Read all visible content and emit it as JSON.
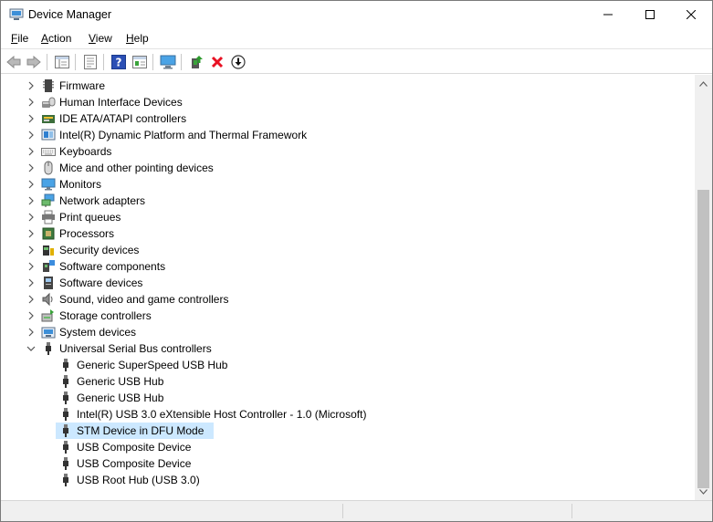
{
  "window": {
    "title": "Device Manager"
  },
  "menu": [
    {
      "label": "File"
    },
    {
      "label": "Action"
    },
    {
      "label": "View"
    },
    {
      "label": "Help"
    }
  ],
  "toolbar": {
    "buttons": [
      {
        "icon": "back-arrow-icon"
      },
      {
        "icon": "forward-arrow-icon"
      },
      {
        "icon": "show-hide-console-tree-icon"
      },
      {
        "icon": "properties-icon"
      },
      {
        "icon": "help-icon"
      },
      {
        "icon": "view-pane-icon"
      },
      {
        "icon": "monitor-icon"
      },
      {
        "icon": "update-driver-icon"
      },
      {
        "icon": "uninstall-red-x-icon"
      },
      {
        "icon": "download-circle-icon"
      }
    ]
  },
  "tree": {
    "categories": [
      {
        "label": "Firmware",
        "icon": "firmware-icon",
        "expanded": false
      },
      {
        "label": "Human Interface Devices",
        "icon": "hid-icon",
        "expanded": false
      },
      {
        "label": "IDE ATA/ATAPI controllers",
        "icon": "ide-icon",
        "expanded": false
      },
      {
        "label": "Intel(R) Dynamic Platform and Thermal Framework",
        "icon": "thermal-framework-icon",
        "expanded": false
      },
      {
        "label": "Keyboards",
        "icon": "keyboard-icon",
        "expanded": false
      },
      {
        "label": "Mice and other pointing devices",
        "icon": "mouse-icon",
        "expanded": false
      },
      {
        "label": "Monitors",
        "icon": "monitor-icon",
        "expanded": false
      },
      {
        "label": "Network adapters",
        "icon": "network-icon",
        "expanded": false
      },
      {
        "label": "Print queues",
        "icon": "printer-icon",
        "expanded": false
      },
      {
        "label": "Processors",
        "icon": "processor-icon",
        "expanded": false
      },
      {
        "label": "Security devices",
        "icon": "security-icon",
        "expanded": false
      },
      {
        "label": "Software components",
        "icon": "software-component-icon",
        "expanded": false
      },
      {
        "label": "Software devices",
        "icon": "software-device-icon",
        "expanded": false
      },
      {
        "label": "Sound, video and game controllers",
        "icon": "speaker-icon",
        "expanded": false
      },
      {
        "label": "Storage controllers",
        "icon": "storage-icon",
        "expanded": false
      },
      {
        "label": "System devices",
        "icon": "system-device-icon",
        "expanded": false
      },
      {
        "label": "Universal Serial Bus controllers",
        "icon": "usb-icon",
        "expanded": true
      }
    ],
    "usb_children": [
      {
        "label": "Generic SuperSpeed USB Hub",
        "icon": "usb-plug-icon",
        "selected": false
      },
      {
        "label": "Generic USB Hub",
        "icon": "usb-plug-icon",
        "selected": false
      },
      {
        "label": "Generic USB Hub",
        "icon": "usb-plug-icon",
        "selected": false
      },
      {
        "label": "Intel(R) USB 3.0 eXtensible Host Controller - 1.0 (Microsoft)",
        "icon": "usb-plug-icon",
        "selected": false
      },
      {
        "label": "STM Device in DFU Mode",
        "icon": "usb-plug-icon",
        "selected": true
      },
      {
        "label": "USB Composite Device",
        "icon": "usb-plug-icon",
        "selected": false
      },
      {
        "label": "USB Composite Device",
        "icon": "usb-plug-icon",
        "selected": false
      },
      {
        "label": "USB Root Hub (USB 3.0)",
        "icon": "usb-plug-icon",
        "selected": false
      }
    ]
  },
  "colors": {
    "selection": "#cce8ff",
    "uninstall_red": "#e81123",
    "help_blue": "#2b4fb5"
  }
}
